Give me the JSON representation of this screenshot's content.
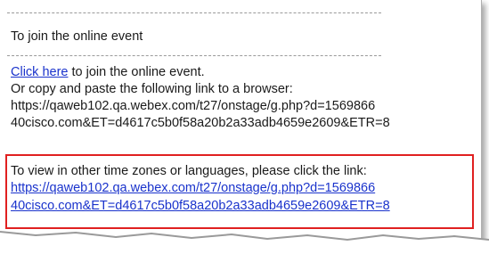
{
  "section": {
    "heading": "To join the online event"
  },
  "join": {
    "link_text": "Click here",
    "after_link": " to join the online event.",
    "copy_instruction": "Or copy and paste the following link to a browser:",
    "url_line1": "https://qaweb102.qa.webex.com/t27/onstage/g.php?d=1569866",
    "url_line2": "40cisco.com&ET=d4617c5b0f58a20b2a33adb4659e2609&ETR=8"
  },
  "timezones": {
    "instruction": "To view in other time zones or languages, please click the link:",
    "url_line1": "https://qaweb102.qa.webex.com/t27/onstage/g.php?d=1569866",
    "url_line2": "40cisco.com&ET=d4617c5b0f58a20b2a33adb4659e2609&ETR=8"
  },
  "colors": {
    "link": "#1a33cc",
    "highlight_border": "#e02020",
    "text": "#1a1a1a"
  }
}
